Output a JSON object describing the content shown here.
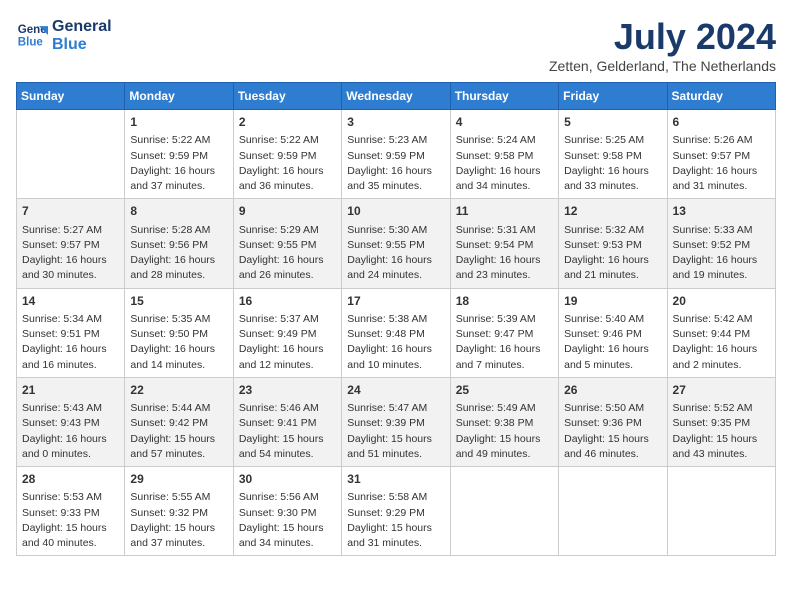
{
  "header": {
    "logo_line1": "General",
    "logo_line2": "Blue",
    "month": "July 2024",
    "location": "Zetten, Gelderland, The Netherlands"
  },
  "days_of_week": [
    "Sunday",
    "Monday",
    "Tuesday",
    "Wednesday",
    "Thursday",
    "Friday",
    "Saturday"
  ],
  "weeks": [
    [
      {
        "day": "",
        "content": ""
      },
      {
        "day": "1",
        "content": "Sunrise: 5:22 AM\nSunset: 9:59 PM\nDaylight: 16 hours\nand 37 minutes."
      },
      {
        "day": "2",
        "content": "Sunrise: 5:22 AM\nSunset: 9:59 PM\nDaylight: 16 hours\nand 36 minutes."
      },
      {
        "day": "3",
        "content": "Sunrise: 5:23 AM\nSunset: 9:59 PM\nDaylight: 16 hours\nand 35 minutes."
      },
      {
        "day": "4",
        "content": "Sunrise: 5:24 AM\nSunset: 9:58 PM\nDaylight: 16 hours\nand 34 minutes."
      },
      {
        "day": "5",
        "content": "Sunrise: 5:25 AM\nSunset: 9:58 PM\nDaylight: 16 hours\nand 33 minutes."
      },
      {
        "day": "6",
        "content": "Sunrise: 5:26 AM\nSunset: 9:57 PM\nDaylight: 16 hours\nand 31 minutes."
      }
    ],
    [
      {
        "day": "7",
        "content": "Sunrise: 5:27 AM\nSunset: 9:57 PM\nDaylight: 16 hours\nand 30 minutes."
      },
      {
        "day": "8",
        "content": "Sunrise: 5:28 AM\nSunset: 9:56 PM\nDaylight: 16 hours\nand 28 minutes."
      },
      {
        "day": "9",
        "content": "Sunrise: 5:29 AM\nSunset: 9:55 PM\nDaylight: 16 hours\nand 26 minutes."
      },
      {
        "day": "10",
        "content": "Sunrise: 5:30 AM\nSunset: 9:55 PM\nDaylight: 16 hours\nand 24 minutes."
      },
      {
        "day": "11",
        "content": "Sunrise: 5:31 AM\nSunset: 9:54 PM\nDaylight: 16 hours\nand 23 minutes."
      },
      {
        "day": "12",
        "content": "Sunrise: 5:32 AM\nSunset: 9:53 PM\nDaylight: 16 hours\nand 21 minutes."
      },
      {
        "day": "13",
        "content": "Sunrise: 5:33 AM\nSunset: 9:52 PM\nDaylight: 16 hours\nand 19 minutes."
      }
    ],
    [
      {
        "day": "14",
        "content": "Sunrise: 5:34 AM\nSunset: 9:51 PM\nDaylight: 16 hours\nand 16 minutes."
      },
      {
        "day": "15",
        "content": "Sunrise: 5:35 AM\nSunset: 9:50 PM\nDaylight: 16 hours\nand 14 minutes."
      },
      {
        "day": "16",
        "content": "Sunrise: 5:37 AM\nSunset: 9:49 PM\nDaylight: 16 hours\nand 12 minutes."
      },
      {
        "day": "17",
        "content": "Sunrise: 5:38 AM\nSunset: 9:48 PM\nDaylight: 16 hours\nand 10 minutes."
      },
      {
        "day": "18",
        "content": "Sunrise: 5:39 AM\nSunset: 9:47 PM\nDaylight: 16 hours\nand 7 minutes."
      },
      {
        "day": "19",
        "content": "Sunrise: 5:40 AM\nSunset: 9:46 PM\nDaylight: 16 hours\nand 5 minutes."
      },
      {
        "day": "20",
        "content": "Sunrise: 5:42 AM\nSunset: 9:44 PM\nDaylight: 16 hours\nand 2 minutes."
      }
    ],
    [
      {
        "day": "21",
        "content": "Sunrise: 5:43 AM\nSunset: 9:43 PM\nDaylight: 16 hours\nand 0 minutes."
      },
      {
        "day": "22",
        "content": "Sunrise: 5:44 AM\nSunset: 9:42 PM\nDaylight: 15 hours\nand 57 minutes."
      },
      {
        "day": "23",
        "content": "Sunrise: 5:46 AM\nSunset: 9:41 PM\nDaylight: 15 hours\nand 54 minutes."
      },
      {
        "day": "24",
        "content": "Sunrise: 5:47 AM\nSunset: 9:39 PM\nDaylight: 15 hours\nand 51 minutes."
      },
      {
        "day": "25",
        "content": "Sunrise: 5:49 AM\nSunset: 9:38 PM\nDaylight: 15 hours\nand 49 minutes."
      },
      {
        "day": "26",
        "content": "Sunrise: 5:50 AM\nSunset: 9:36 PM\nDaylight: 15 hours\nand 46 minutes."
      },
      {
        "day": "27",
        "content": "Sunrise: 5:52 AM\nSunset: 9:35 PM\nDaylight: 15 hours\nand 43 minutes."
      }
    ],
    [
      {
        "day": "28",
        "content": "Sunrise: 5:53 AM\nSunset: 9:33 PM\nDaylight: 15 hours\nand 40 minutes."
      },
      {
        "day": "29",
        "content": "Sunrise: 5:55 AM\nSunset: 9:32 PM\nDaylight: 15 hours\nand 37 minutes."
      },
      {
        "day": "30",
        "content": "Sunrise: 5:56 AM\nSunset: 9:30 PM\nDaylight: 15 hours\nand 34 minutes."
      },
      {
        "day": "31",
        "content": "Sunrise: 5:58 AM\nSunset: 9:29 PM\nDaylight: 15 hours\nand 31 minutes."
      },
      {
        "day": "",
        "content": ""
      },
      {
        "day": "",
        "content": ""
      },
      {
        "day": "",
        "content": ""
      }
    ]
  ]
}
